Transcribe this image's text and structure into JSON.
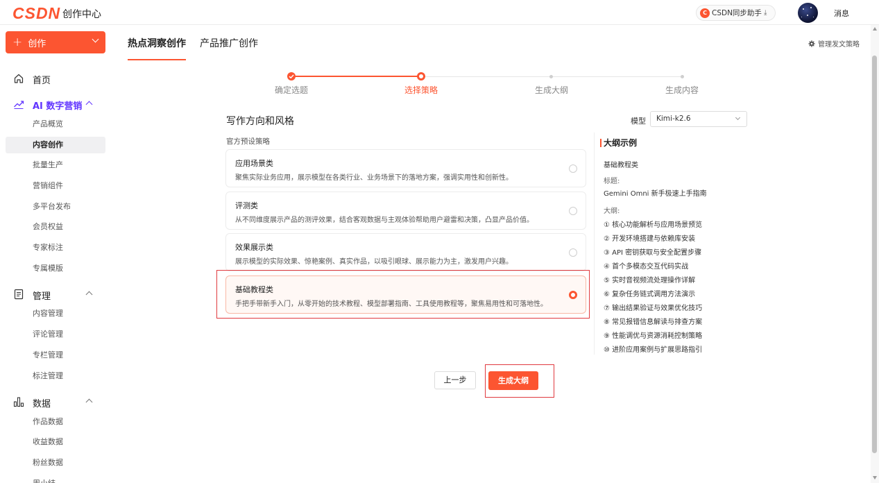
{
  "header": {
    "logo": "CSDN",
    "title": "创作中心",
    "sync_label": "CSDN同步助手",
    "sync_download": "⤓",
    "messages": "消息",
    "brand_color": "#fc5531"
  },
  "sidebar": {
    "create_label": "创作",
    "groups": [
      {
        "label": "首页",
        "icon": "home-icon"
      },
      {
        "label": "AI 数字营销",
        "icon": "trend-chart-icon"
      },
      {
        "label": "管理",
        "icon": "document-icon"
      },
      {
        "label": "数据",
        "icon": "bar-chart-icon"
      }
    ],
    "ai_items": [
      "产品概览",
      "内容创作",
      "批量生产",
      "营销组件",
      "多平台发布",
      "会员权益",
      "专家标注",
      "专属模版"
    ],
    "manage_items": [
      "内容管理",
      "评论管理",
      "专栏管理",
      "标注管理"
    ],
    "data_items": [
      "作品数据",
      "收益数据",
      "粉丝数据",
      "周小结"
    ],
    "active_color": "#6236ff"
  },
  "tabs": [
    {
      "label": "热点洞察创作",
      "active": true
    },
    {
      "label": "产品推广创作",
      "active": false
    }
  ],
  "strategy_link": "管理发文策略",
  "stepper": {
    "current_step": 2,
    "steps": [
      {
        "label": "确定选题",
        "state": "done"
      },
      {
        "label": "选择策略",
        "state": "current"
      },
      {
        "label": "生成大纲",
        "state": "pending"
      },
      {
        "label": "生成内容",
        "state": "pending"
      }
    ]
  },
  "section_title": "写作方向和风格",
  "model": {
    "label": "模型",
    "value": "Kimi-k2.6"
  },
  "preset_label": "官方预设策略",
  "cards": [
    {
      "title": "应用场景类",
      "desc": "聚焦实际业务应用，展示模型在各类行业、业务场景下的落地方案，强调实用性和创新性。",
      "selected": false
    },
    {
      "title": "评测类",
      "desc": "从不同维度展示产品的测评效果，结合客观数据与主观体验帮助用户避雷和决策，凸显产品价值。",
      "selected": false
    },
    {
      "title": "效果展示类",
      "desc": "展示模型的实际效果、惊艳案例、真实作品，以吸引眼球、展示能力为主，激发用户兴趣。",
      "selected": false
    },
    {
      "title": "基础教程类",
      "desc": "手把手带新手入门，从零开始的技术教程、模型部署指南、工具使用教程等，聚焦易用性和可落地性。",
      "selected": true
    }
  ],
  "outline": {
    "title": "大纲示例",
    "category": "基础教程类",
    "heading_label": "标题:",
    "heading_value": "Gemini Omni 新手极速上手指南",
    "outline_label": "大纲:",
    "items": [
      "① 核心功能解析与应用场景预览",
      "② 开发环境搭建与依赖库安装",
      "③ API 密钥获取与安全配置步骤",
      "④ 首个多模态交互代码实战",
      "⑤ 实时音视频流处理操作详解",
      "⑥ 复杂任务链式调用方法演示",
      "⑦ 输出结果验证与效果优化技巧",
      "⑧ 常见报错信息解读与排查方案",
      "⑨ 性能调优与资源消耗控制策略",
      "⑩ 进阶应用案例与扩展思路指引"
    ]
  },
  "buttons": {
    "prev": "上一步",
    "generate": "生成大纲"
  }
}
